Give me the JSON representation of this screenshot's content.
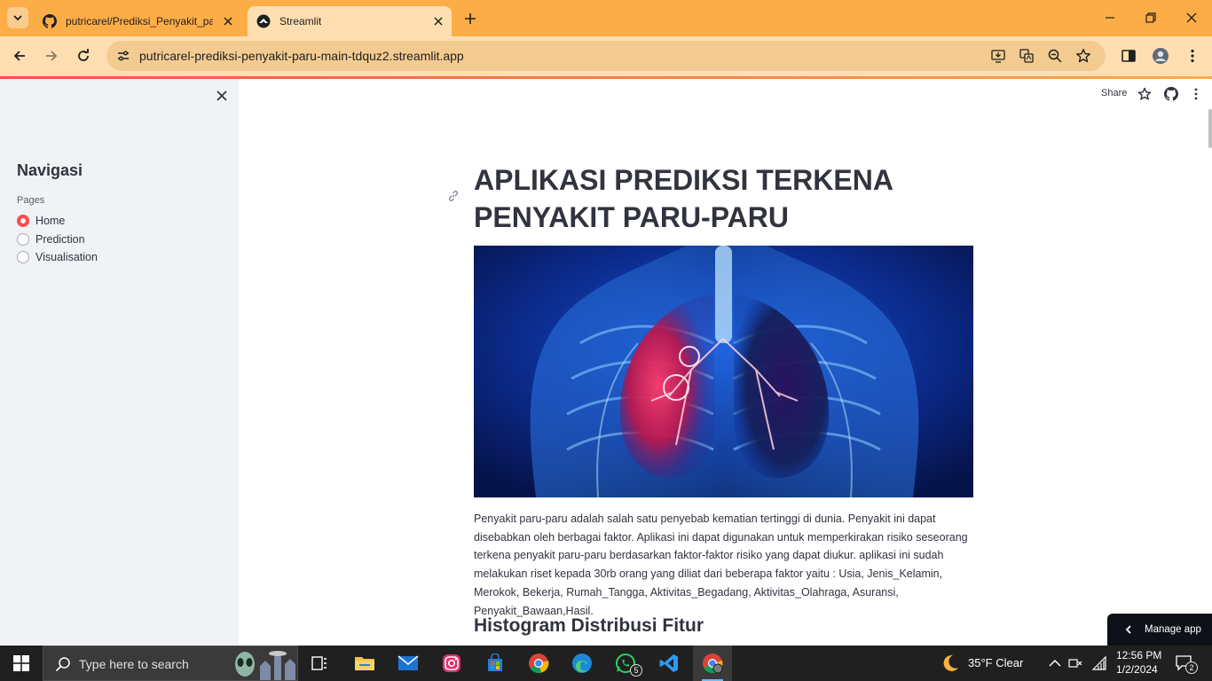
{
  "browser": {
    "tabs": [
      {
        "title": "putricarel/Prediksi_Penyakit_paru",
        "icon": "github-icon"
      },
      {
        "title": "Streamlit",
        "icon": "streamlit-icon",
        "active": true
      }
    ],
    "url": "putricarel-prediksi-penyakit-paru-main-tdquz2.streamlit.app",
    "accent_color": "#fdad48"
  },
  "sidebar": {
    "title": "Navigasi",
    "pages_label": "Pages",
    "options": [
      {
        "label": "Home",
        "selected": true
      },
      {
        "label": "Prediction",
        "selected": false
      },
      {
        "label": "Visualisation",
        "selected": false
      }
    ]
  },
  "header": {
    "share_label": "Share"
  },
  "main": {
    "title": "APLIKASI PREDIKSI TERKENA PENYAKIT PARU-PARU",
    "image_description": "lungs x-ray illustration",
    "description": "Penyakit paru-paru adalah salah satu penyebab kematian tertinggi di dunia. Penyakit ini dapat disebabkan oleh berbagai faktor. Aplikasi ini dapat digunakan untuk memperkirakan risiko seseorang terkena penyakit paru-paru berdasarkan faktor-faktor risiko yang dapat diukur. aplikasi ini sudah melakukan riset kepada 30rb orang yang diliat dari beberapa faktor yaitu : Usia, Jenis_Kelamin, Merokok, Bekerja, Rumah_Tangga, Aktivitas_Begadang, Aktivitas_Olahraga, Asuransi, Penyakit_Bawaan,Hasil.",
    "subheading": "Histogram Distribusi Fitur"
  },
  "manage_app": {
    "label": "Manage app"
  },
  "taskbar": {
    "search_placeholder": "Type here to search",
    "whatsapp_badge": "5",
    "weather": "35°F  Clear",
    "time": "12:56 PM",
    "date": "1/2/2024",
    "notification_count": "2"
  }
}
